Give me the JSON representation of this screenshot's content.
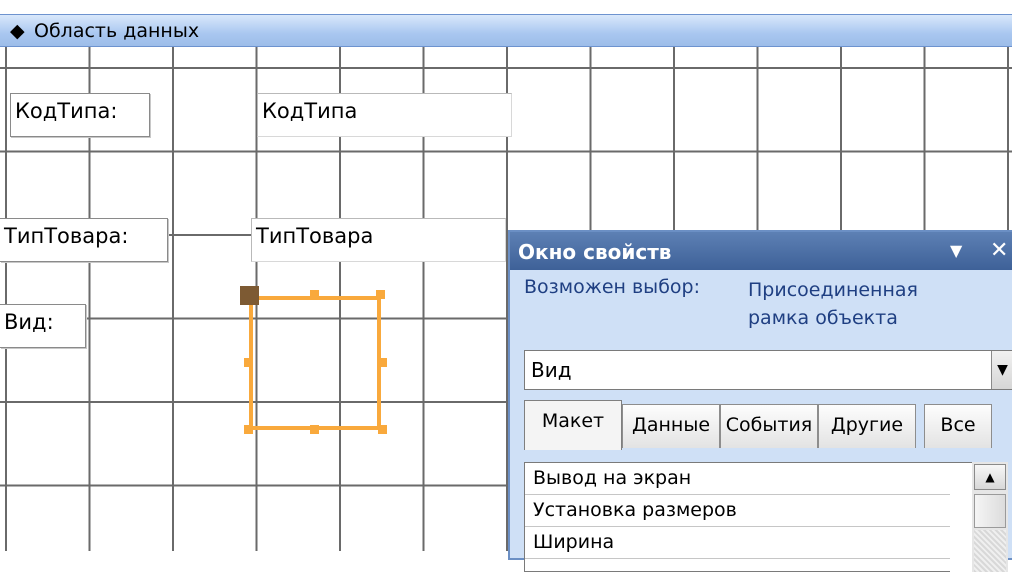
{
  "section": {
    "arrow_glyph": "◆",
    "title": "Область данных"
  },
  "form": {
    "kod_label": "КодТипа:",
    "kod_field": "КодТипа",
    "tip_label": "ТипТовара:",
    "tip_field": "ТипТовара",
    "vid_label": "Вид:"
  },
  "properties": {
    "title": "Окно свойств",
    "selection_caption": "Возможен выбор:",
    "selection_value": "Присоединенная\nрамка объекта",
    "object_combo": "Вид",
    "tabs": [
      "Макет",
      "Данные",
      "События",
      "Другие",
      "Все"
    ],
    "rows": [
      "Вывод на экран",
      "Установка размеров",
      "Ширина"
    ]
  },
  "colors": {
    "selection": "#f9a93c",
    "titlebar": "#4a6ea6",
    "panel": "#cfe0f6"
  }
}
